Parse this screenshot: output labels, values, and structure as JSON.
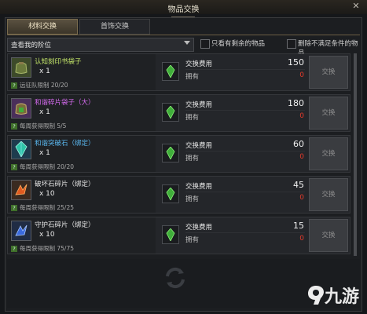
{
  "window": {
    "title": "物品交换",
    "close_glyph": "✕"
  },
  "tabs": [
    {
      "label": "材料交换",
      "active": true
    },
    {
      "label": "首饰交换",
      "active": false
    }
  ],
  "filters": {
    "dropdown_value": "查看我的阶位",
    "checkbox_remaining": "只看有剩余的物品",
    "checkbox_delete": "删除不满足条件的物品"
  },
  "labels": {
    "cost": "交换费用",
    "own": "拥有",
    "exchange": "交换"
  },
  "items": [
    {
      "name": "认知刻印书袋子",
      "name_color": "#c6e86a",
      "qty": "x 1",
      "limit": "远征队限制 20/20",
      "cost": "150",
      "owned": "0",
      "icon": "bag-icon",
      "icon_bg": "#3d4a2a"
    },
    {
      "name": "和谐碎片袋子（大）",
      "name_color": "#d66bf0",
      "qty": "x 1",
      "limit": "每周获得限制 5/5",
      "cost": "180",
      "owned": "0",
      "icon": "bag-icon",
      "icon_bg": "#4a2f5a"
    },
    {
      "name": "和谐突破石（绑定）",
      "name_color": "#5ab8f0",
      "qty": "x 1",
      "limit": "每周获得限制 20/20",
      "cost": "60",
      "owned": "0",
      "icon": "crystal-icon",
      "icon_bg": "#1e3c4e"
    },
    {
      "name": "破坏石碎片（绑定）",
      "name_color": "#e4e4e4",
      "qty": "x 10",
      "limit": "每周获得限制 25/25",
      "cost": "45",
      "owned": "0",
      "icon": "red-shard-icon",
      "icon_bg": "#3a2a20"
    },
    {
      "name": "守护石碎片（绑定）",
      "name_color": "#e4e4e4",
      "qty": "x 10",
      "limit": "每周获得限制 75/75",
      "cost": "15",
      "owned": "0",
      "icon": "blue-shard-icon",
      "icon_bg": "#202c44"
    }
  ],
  "watermark": {
    "text": "九游"
  },
  "colors": {
    "accent_gold": "#7a6c4e",
    "owned_red": "#e23a2a",
    "badge_green": "#3f6f2a"
  }
}
